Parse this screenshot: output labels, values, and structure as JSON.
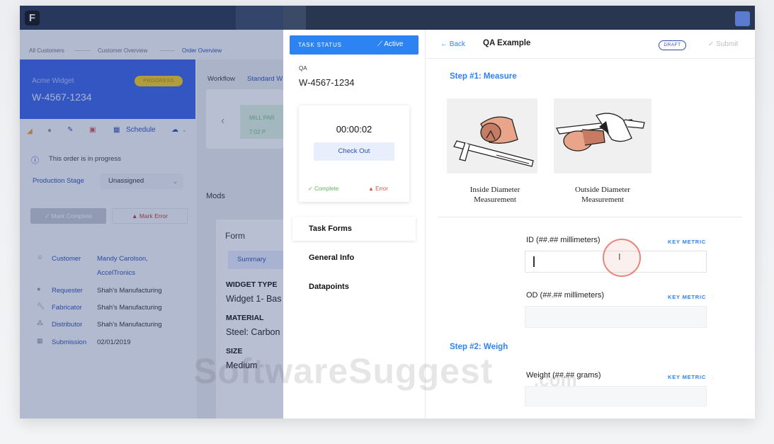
{
  "app": {
    "logo_letter": "F"
  },
  "breadcrumbs": [
    "All Customers",
    "Customer Overview",
    "Order Overview"
  ],
  "order": {
    "title": "Acme Widget",
    "id": "W-4567-1234",
    "status_badge": "PROGRESS"
  },
  "toolbar": {
    "schedule_label": "Schedule"
  },
  "order_status": {
    "message": "This order is in progress",
    "production_stage_label": "Production Stage",
    "production_stage_value": "Unassigned"
  },
  "actions": {
    "mark_complete": "Mark Complete",
    "mark_error": "Mark Error"
  },
  "info": [
    {
      "label": "Customer",
      "value": "Mandy Carolson,",
      "value2": "AccelTronics",
      "icon": "smiley-icon"
    },
    {
      "label": "Requester",
      "value": "Shah's Manufacturing",
      "icon": "person-icon"
    },
    {
      "label": "Fabricator",
      "value": "Shah's Manufacturing",
      "icon": "wrench-icon"
    },
    {
      "label": "Distributor",
      "value": "Shah's Manufacturing",
      "icon": "distributor-icon"
    },
    {
      "label": "Submission",
      "value": "02/01/2019",
      "icon": "calendar-icon"
    }
  ],
  "workflow": {
    "label": "Workflow",
    "value": "Standard W",
    "card_label": "MILL PAR",
    "card_sub": "7:02 P"
  },
  "mods": {
    "label": "Mods"
  },
  "form": {
    "title": "Form",
    "tab_summary": "Summary",
    "specs": [
      {
        "heading": "WIDGET TYPE",
        "value": "Widget 1- Bas"
      },
      {
        "heading": "MATERIAL",
        "value": "Steel: Carbon"
      },
      {
        "heading": "SIZE",
        "value": "Medium"
      }
    ]
  },
  "task_status": {
    "header": "TASK STATUS",
    "state": "Active",
    "qa_label": "QA",
    "order_id": "W-4567-1234",
    "timer": "00:00:02",
    "check_out": "Check Out",
    "complete": "Complete",
    "error": "Error",
    "nav": [
      "Task Forms",
      "General Info",
      "Datapoints"
    ]
  },
  "qa_form": {
    "back": "Back",
    "title": "QA Example",
    "badge": "DRAFT",
    "submit": "Submit",
    "step1": "Step #1: Measure",
    "illustrations": [
      {
        "caption1": "Inside Diameter",
        "caption2": "Measurement"
      },
      {
        "caption1": "Outside Diameter",
        "caption2": "Measurement"
      }
    ],
    "fields": [
      {
        "label": "ID (##.## millimeters)",
        "tag": "KEY METRIC",
        "value": ""
      },
      {
        "label": "OD (##.## millimeters)",
        "tag": "KEY METRIC",
        "value": ""
      },
      {
        "label": "Weight (##.## grams)",
        "tag": "KEY METRIC",
        "value": ""
      }
    ],
    "step2": "Step #2: Weigh"
  },
  "watermark": {
    "text": "SoftwareSuggest",
    "suffix": ".com"
  }
}
